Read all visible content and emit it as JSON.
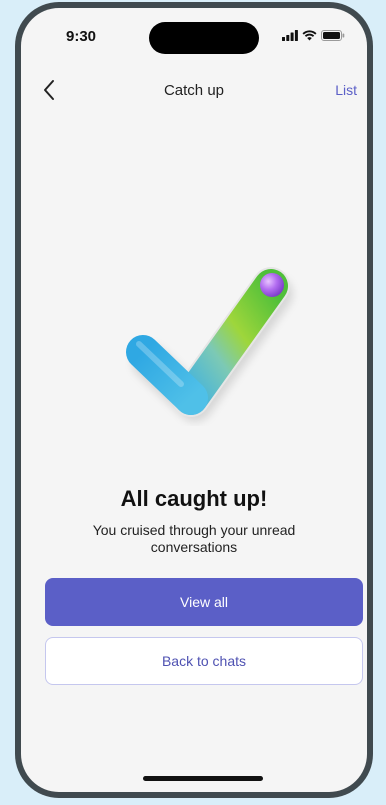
{
  "status_bar": {
    "time": "9:30"
  },
  "nav": {
    "title": "Catch up",
    "right_action": "List"
  },
  "content": {
    "headline": "All caught up!",
    "subtext": "You cruised through your unread conversations"
  },
  "buttons": {
    "primary": "View all",
    "secondary": "Back to chats"
  },
  "colors": {
    "accent": "#5b5fc7",
    "background": "#f5f5f5",
    "frame_backdrop": "#d9eef9"
  },
  "icons": {
    "back": "chevron-left-icon",
    "illustration": "checkmark-illustration"
  }
}
